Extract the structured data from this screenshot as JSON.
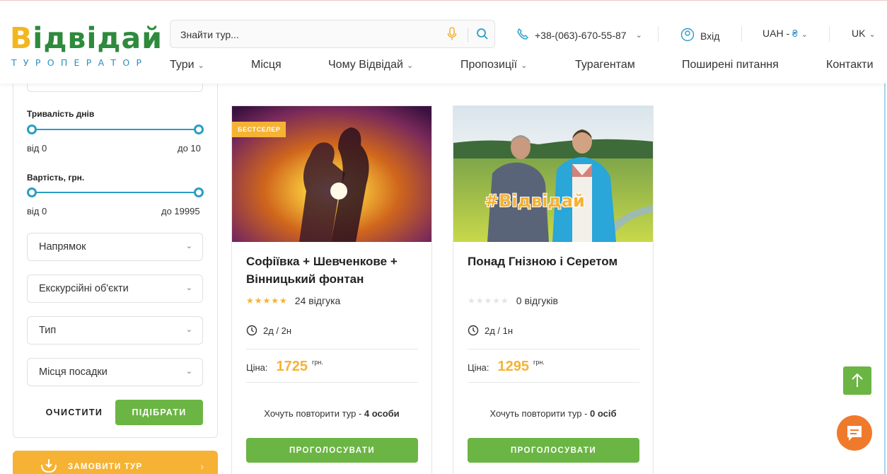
{
  "header": {
    "logo_word_first": "В",
    "logo_word_rest": "ідвідай",
    "logo_sub": "ТУРОПЕРАТОР",
    "search_placeholder": "Знайти тур...",
    "phone": "+38-(063)-670-55-87",
    "login": "Вхід",
    "currency": "UAH - ",
    "currency_symbol": "₴",
    "lang": "UK",
    "icons": [
      "microphone-icon",
      "search-icon",
      "phone-icon",
      "user-icon",
      "chevron-down-icon"
    ]
  },
  "nav": {
    "tours": "Тури",
    "places": "Місця",
    "why": "Чому Відвідай",
    "offers": "Пропозиції",
    "agents": "Турагентам",
    "faq": "Поширені питання",
    "contacts": "Контакти"
  },
  "filters": {
    "days_label": "Тривалість днів",
    "days_from": "від 0",
    "days_to": "до 10",
    "price_label": "Вартість, грн.",
    "price_from": "від 0",
    "price_to": "до 19995",
    "direction": "Напрямок",
    "objects": "Екскурсійні об'єкти",
    "type": "Тип",
    "boarding": "Місця посадки",
    "clear": "ОЧИСТИТИ",
    "apply": "ПІДІБРАТИ",
    "order": "ЗАМОВИТИ ТУР"
  },
  "cards": [
    {
      "badge": "БЕСТСЕЛЕР",
      "title": "Софіївка + Шевченкове + Вінницький фонтан",
      "stars": "★★★★★",
      "reviews": "24 відгука",
      "duration": "2д / 2н",
      "price_label": "Ціна:",
      "price": "1725",
      "currency": "грн.",
      "repeat_text": "Хочуть повторити тур - ",
      "repeat_count": "4 особи",
      "vote": "ПРОГОЛОСУВАТИ"
    },
    {
      "title": "Понад Гнізною і Серетом",
      "stars": "★★★★★",
      "reviews": "0 відгуків",
      "duration": "2д / 1н",
      "price_label": "Ціна:",
      "price": "1295",
      "currency": "грн.",
      "repeat_text": "Хочуть повторити тур - ",
      "repeat_count": "0 осіб",
      "vote": "ПРОГОЛОСУВАТИ",
      "photo_caption": "#Відвідай"
    }
  ],
  "colors": {
    "green": "#6bb544",
    "orange": "#f6b234",
    "blue": "#2a9ec5",
    "chat": "#f07a2c"
  }
}
